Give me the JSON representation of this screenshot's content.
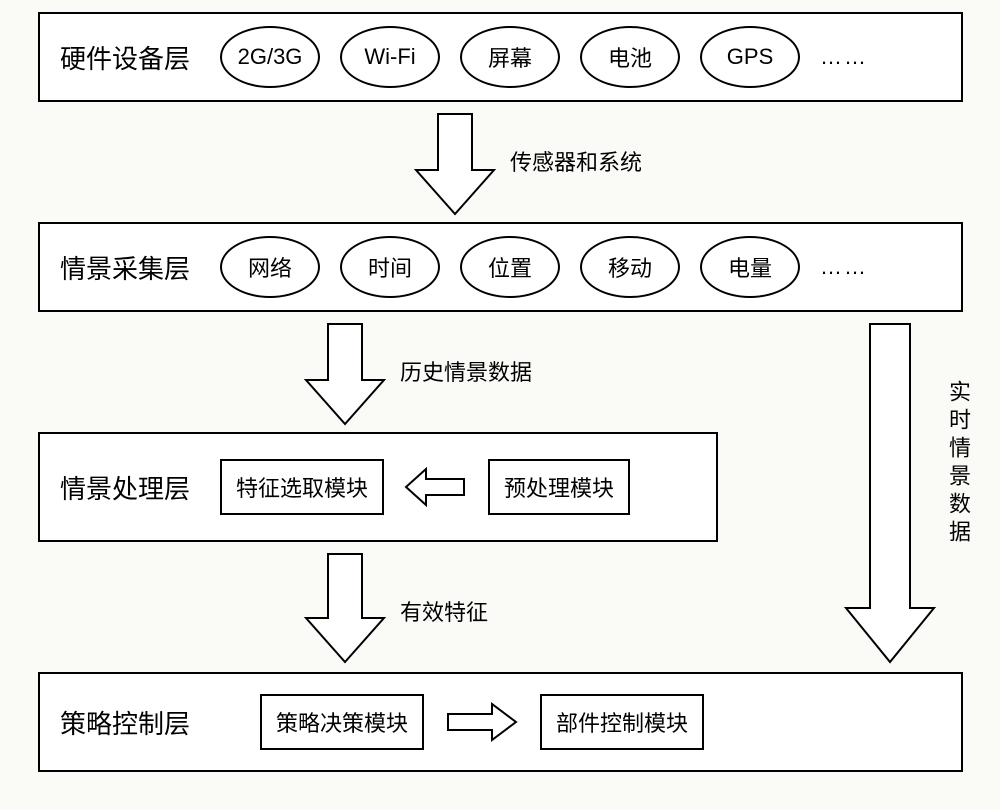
{
  "layers": {
    "hardware": {
      "title": "硬件设备层",
      "items": [
        "2G/3G",
        "Wi-Fi",
        "屏幕",
        "电池",
        "GPS"
      ],
      "more": "……"
    },
    "collection": {
      "title": "情景采集层",
      "items": [
        "网络",
        "时间",
        "位置",
        "移动",
        "电量"
      ],
      "more": "……"
    },
    "processing": {
      "title": "情景处理层",
      "feature_module": "特征选取模块",
      "preprocess_module": "预处理模块"
    },
    "control": {
      "title": "策略控制层",
      "decision_module": "策略决策模块",
      "component_module": "部件控制模块"
    }
  },
  "arrows": {
    "a1": "传感器和系统",
    "a2": "历史情景数据",
    "a3": "有效特征",
    "side": "实时情景数据"
  }
}
